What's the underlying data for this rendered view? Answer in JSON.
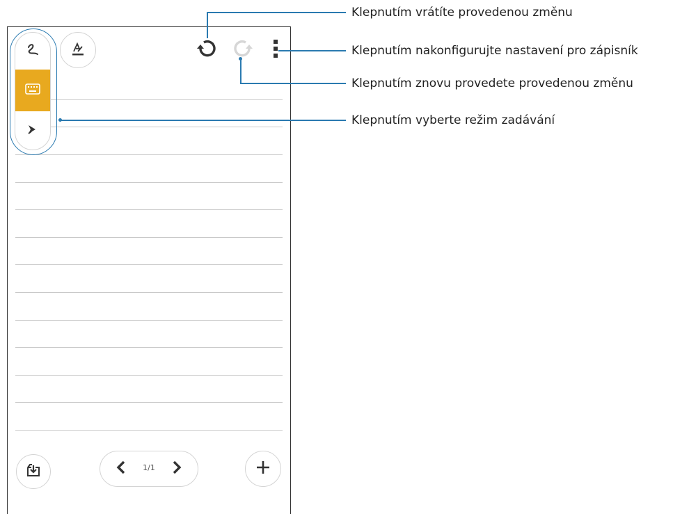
{
  "notebook": {
    "mode_buttons": [
      {
        "icon": "handwriting-icon",
        "active": false
      },
      {
        "icon": "keyboard-icon",
        "active": true
      },
      {
        "icon": "pen-icon",
        "active": false
      }
    ],
    "toolbar_icons": [
      "format-text-icon",
      "undo-icon",
      "redo-icon",
      "more-vert-icon"
    ],
    "bottom_icons": [
      "import-icon",
      "chevron-left-icon",
      "chevron-right-icon",
      "add-icon"
    ],
    "page_indicator": "1/1"
  },
  "callouts": {
    "undo": "Klepnutím vrátíte provedenou změnu",
    "settings": "Klepnutím nakonfigurujte nastavení pro zápisník",
    "redo": "Klepnutím znovu provedete provedenou změnu",
    "input_mode": "Klepnutím vyberte režim zadávání"
  },
  "colors": {
    "accent_active": "#e8a91f",
    "callout_line": "#2a7ab0",
    "icon": "#333333",
    "disabled_icon": "#d0d0d0"
  }
}
